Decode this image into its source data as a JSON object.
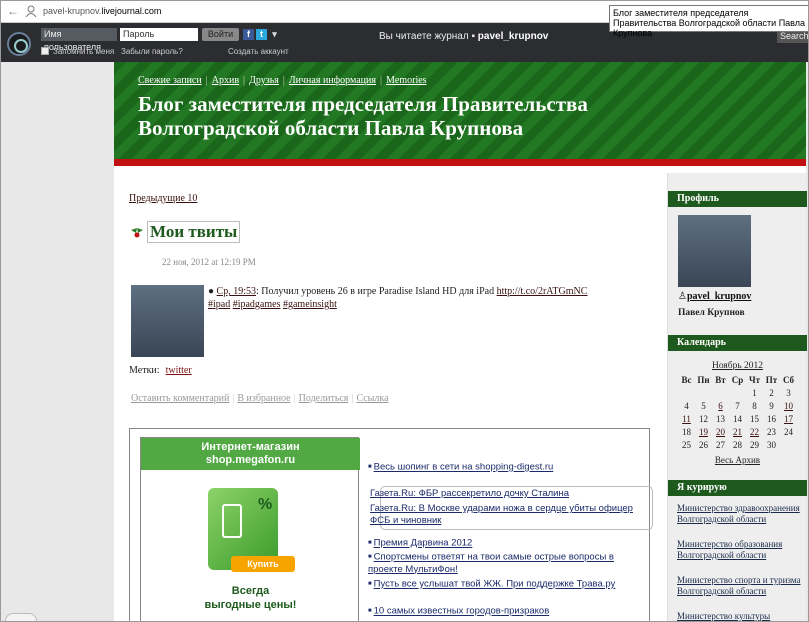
{
  "browser": {
    "url_prefix": "pavel-krupnov.",
    "url_domain": "livejournal.com",
    "tooltip": "Блог заместителя председателя Правительства Волгоградской области Павла Крупнова"
  },
  "lj_bar": {
    "username_placeholder": "Имя пользователя",
    "password_placeholder": "Пароль",
    "login_label": "Войти",
    "remember_label": "Запомнить меня",
    "forgot_label": "Забыли пароль?",
    "create_label": "Создать аккаунт",
    "reading_prefix": "Вы читаете журнал",
    "reading_user": "pavel_krupnov",
    "search_label": "Search"
  },
  "header": {
    "nav": [
      "Свежие записи",
      "Архив",
      "Друзья",
      "Личная информация",
      "Memories"
    ],
    "title": "Блог заместителя председателя Правительства Волгоградской области Павла Крупнова"
  },
  "post": {
    "prev_link": "Предыдущие 10",
    "title": "Мои твиты",
    "date": "22 ноя, 2012 at 12:19 PM",
    "tweet_time": "Ср, 19:53",
    "tweet_text": ": Получил уровень 26 в игре Paradise Island HD для iPad ",
    "tweet_link": "http://t.co/2rATGmNC",
    "hashtags": [
      "#ipad",
      "#ipadgames",
      "#gameinsight"
    ],
    "tags_label": "Метки:",
    "tag": "twitter",
    "actions": [
      "Оставить комментарий",
      "В избранное",
      "Поделиться",
      "Ссылка"
    ]
  },
  "ad": {
    "megafon_line1": "Интернет-магазин",
    "megafon_line2": "shop.megafon.ru",
    "megafon_pct": "%",
    "megafon_buy": "Купить",
    "megafon_slogan1": "Всегда",
    "megafon_slogan2": "выгодные цены!",
    "links": [
      "Весь шопинг в сети на shopping-digest.ru",
      "Газета.Ru: ФБР рассекретило дочку Сталина",
      "Газета.Ru: В Москве ударами ножа в сердце убиты офицер ФСБ и чиновник",
      "Премия Дарвина 2012",
      "Спортсмены ответят на твои самые острые вопросы в проекте МультиФон!",
      "Пусть все услышат твой ЖЖ. При поддержке Трава.ру",
      "10 самых известных городов-призраков"
    ]
  },
  "sidebar": {
    "profile_head": "Профиль",
    "username": "pavel_krupnov",
    "full_name": "Павел Крупнов",
    "calendar_head": "Календарь",
    "month": "Ноябрь 2012",
    "weekdays": [
      "Вс",
      "Пн",
      "Вт",
      "Ср",
      "Чт",
      "Пт",
      "Сб"
    ],
    "weeks": [
      [
        "",
        "",
        "",
        "",
        "1",
        "2",
        "3"
      ],
      [
        "4",
        "5",
        "6",
        "7",
        "8",
        "9",
        "10"
      ],
      [
        "11",
        "12",
        "13",
        "14",
        "15",
        "16",
        "17"
      ],
      [
        "18",
        "19",
        "20",
        "21",
        "22",
        "23",
        "24"
      ],
      [
        "25",
        "26",
        "27",
        "28",
        "29",
        "30",
        ""
      ]
    ],
    "linked_days": [
      "6",
      "10",
      "11",
      "17",
      "19",
      "20",
      "21",
      "22"
    ],
    "archive": "Весь Архив",
    "curate_head": "Я курирую",
    "curated": [
      "Министерство здравоохранения Волгоградской области",
      "Министерство образования Волгоградской области",
      "Министерство спорта и туризма Волгоградской области",
      "Министерство культуры"
    ]
  }
}
